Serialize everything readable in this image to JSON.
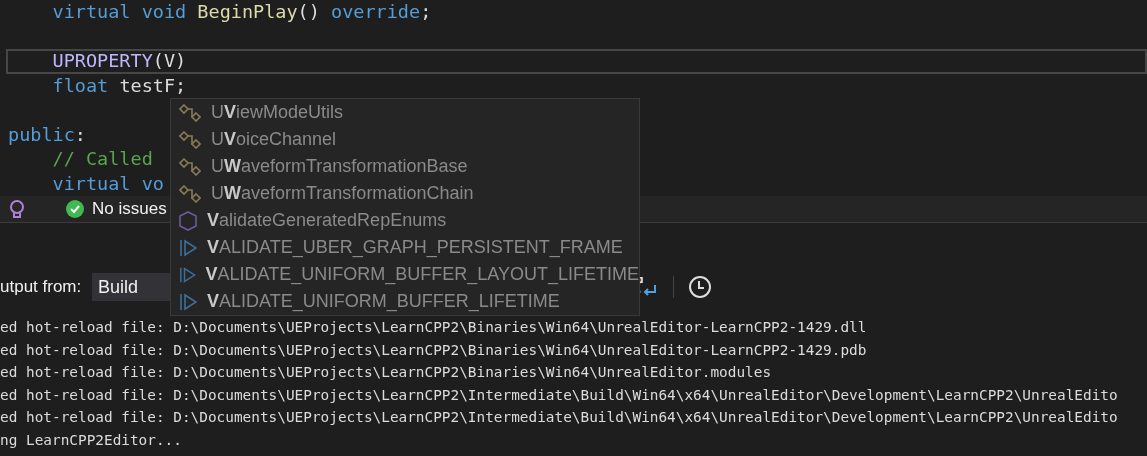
{
  "editor": {
    "lines": [
      {
        "current": false,
        "indented": true,
        "tokens": [
          {
            "t": "virtual ",
            "kind": "keyword"
          },
          {
            "t": "void ",
            "kind": "keyword"
          },
          {
            "t": "BeginPlay",
            "kind": "function"
          },
          {
            "t": "() ",
            "kind": "plain"
          },
          {
            "t": "override",
            "kind": "keyword"
          },
          {
            "t": ";",
            "kind": "plain"
          }
        ]
      },
      {
        "current": false
      },
      {
        "current": true,
        "indented": true,
        "tokens": [
          {
            "t": "UPROPERTY",
            "kind": "macro"
          },
          {
            "t": "(V)",
            "kind": "plain"
          }
        ]
      },
      {
        "current": false,
        "indented": true,
        "tokens": [
          {
            "t": "float ",
            "kind": "keyword"
          },
          {
            "t": "testF;",
            "kind": "plain"
          }
        ]
      },
      {
        "current": false
      },
      {
        "current": false,
        "indented": false,
        "tokens": [
          {
            "t": "public",
            "kind": "keyword"
          },
          {
            "t": ":",
            "kind": "plain"
          }
        ]
      },
      {
        "current": false,
        "indented": true,
        "tokens": [
          {
            "t": "// Called",
            "kind": "comment"
          }
        ]
      },
      {
        "current": false,
        "indented": true,
        "tokens": [
          {
            "t": "virtual ",
            "kind": "keyword"
          },
          {
            "t": "vo",
            "kind": "keyword"
          }
        ]
      }
    ]
  },
  "completion_list": [
    {
      "kind": "class",
      "label": "U**V**iewModeUtils"
    },
    {
      "kind": "class",
      "label": "U**V**oiceChannel"
    },
    {
      "kind": "class",
      "label": "U**W**aveformTransformationBase"
    },
    {
      "kind": "class",
      "label": "U**W**aveformTransformationChain"
    },
    {
      "kind": "struct",
      "label": "**V**alidateGeneratedRepEnums"
    },
    {
      "kind": "macro",
      "label": "**V**ALIDATE_UBER_GRAPH_PERSISTENT_FRAME"
    },
    {
      "kind": "macro",
      "label": "**V**ALIDATE_UNIFORM_BUFFER_LAYOUT_LIFETIME"
    },
    {
      "kind": "macro",
      "label": "**V**ALIDATE_UNIFORM_BUFFER_LIFETIME"
    }
  ],
  "status_bar": {
    "issues": "No issues"
  },
  "output": {
    "label": "utput from:",
    "source": "Build",
    "lines": [
      "ed hot-reload file: D:\\Documents\\UEProjects\\LearnCPP2\\Binaries\\Win64\\UnrealEditor-LearnCPP2-1429.dll",
      "ed hot-reload file: D:\\Documents\\UEProjects\\LearnCPP2\\Binaries\\Win64\\UnrealEditor-LearnCPP2-1429.pdb",
      "ed hot-reload file: D:\\Documents\\UEProjects\\LearnCPP2\\Binaries\\Win64\\UnrealEditor.modules",
      "ed hot-reload file: D:\\Documents\\UEProjects\\LearnCPP2\\Intermediate\\Build\\Win64\\x64\\UnrealEditor\\Development\\LearnCPP2\\UnrealEdito",
      "ed hot-reload file: D:\\Documents\\UEProjects\\LearnCPP2\\Intermediate\\Build\\Win64\\x64\\UnrealEditor\\Development\\LearnCPP2\\UnrealEdito",
      "ng LearnCPP2Editor..."
    ]
  }
}
